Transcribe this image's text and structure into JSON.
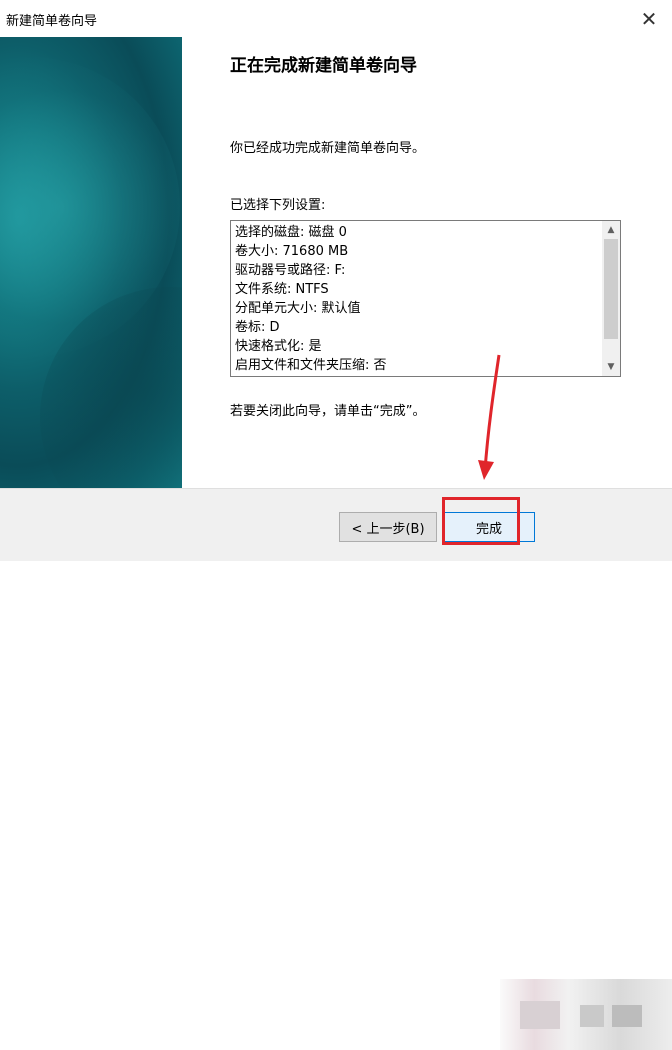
{
  "window": {
    "title": "新建简单卷向导",
    "close_glyph": "✕"
  },
  "main": {
    "heading": "正在完成新建简单卷向导",
    "message": "你已经成功完成新建简单卷向导。",
    "settings_label": "已选择下列设置:",
    "settings": [
      "选择的磁盘: 磁盘 0",
      "卷大小: 71680 MB",
      "驱动器号或路径: F:",
      "文件系统: NTFS",
      "分配单元大小: 默认值",
      "卷标: D",
      "快速格式化: 是",
      "启用文件和文件夹压缩: 否"
    ],
    "footer_message": "若要关闭此向导，请单击“完成”。"
  },
  "buttons": {
    "back_label": "< 上一步(B)",
    "finish_label": "完成"
  },
  "colors": {
    "annotation_red": "#e0252b",
    "side_panel_teal": "#0d5e69"
  },
  "icons": {
    "close": "close-icon",
    "scroll_up": "chevron-up-icon",
    "scroll_down": "chevron-down-icon"
  }
}
